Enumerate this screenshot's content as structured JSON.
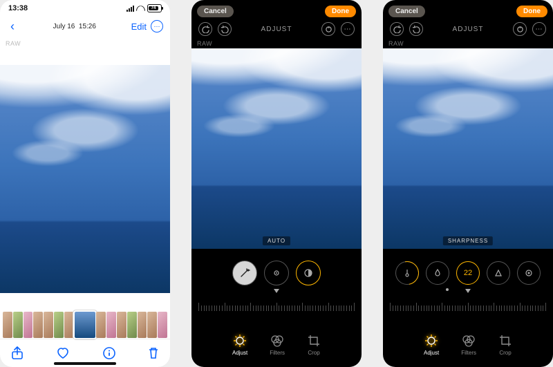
{
  "panel1": {
    "status": {
      "time": "13:38",
      "battery": "74"
    },
    "nav": {
      "date": "July 16",
      "time": "15:26",
      "edit": "Edit"
    },
    "raw": "RAW",
    "toolbar": {
      "share": "share",
      "favorite": "favorite",
      "info": "info",
      "delete": "delete"
    }
  },
  "panel2": {
    "cancel": "Cancel",
    "done": "Done",
    "title": "ADJUST",
    "raw": "RAW",
    "mode_label": "AUTO",
    "tools": {
      "wand": "auto-wand",
      "exposure": "exposure",
      "brilliance": "brilliance"
    },
    "bottom": {
      "adjust": "Adjust",
      "filters": "Filters",
      "crop": "Crop"
    }
  },
  "panel3": {
    "cancel": "Cancel",
    "done": "Done",
    "title": "ADJUST",
    "raw": "RAW",
    "mode_label": "SHARPNESS",
    "value": "22",
    "tools": {
      "warmth": "warmth",
      "tint": "tint",
      "sharpness": "sharpness",
      "definition": "definition",
      "noise": "noise-reduction"
    },
    "bottom": {
      "adjust": "Adjust",
      "filters": "Filters",
      "crop": "Crop"
    }
  }
}
